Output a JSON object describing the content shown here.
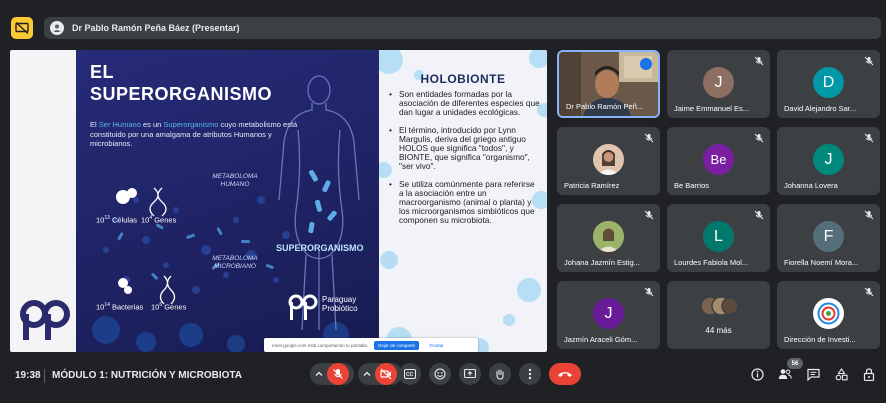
{
  "topbar": {
    "presenter_label": "Dr Pablo Ramón Peña Báez (Presentar)"
  },
  "slide": {
    "title_line1": "EL",
    "title_line2": "SUPERORGANISMO",
    "intro_part1": "El ",
    "intro_hl1": "Ser Humano",
    "intro_part2": " es un ",
    "intro_hl2": "Superorganismo",
    "intro_part3": " cuyo metabolismo está constituido por una amalgama de atributos Humanos y microbianos.",
    "metaboloma_humano": "METABOLOMA HUMANO",
    "metaboloma_microbiano": "METABOLOMA MICROBIANO",
    "celulas": "Células",
    "genes1": "Genes",
    "bacterias": "Bacterias",
    "genes2": "Genes",
    "base": "10",
    "superorganismo_label": "SUPERORGANISMO",
    "logo_text": "Paraguay Probiótico",
    "right_title": "HOLOBIONTE",
    "bullets": [
      "Son entidades formadas por la asociación de diferentes especies que dan lugar a unidades ecológicas.",
      "El término, introducido por Lynn Margulis, deriva del griego antiguo HOLOS que significa \"todos\", y BIONTE, que significa \"organismo\", \"ser vivo\".",
      "Se utiliza comúnmente para referirse a la asociación entre un macroorganismo (animal o planta) y los microorganismos simbióticos que componen su microbiota."
    ]
  },
  "share_bar": {
    "text": "meet.google.com está compartiendo tu pantalla.",
    "stop_button": "Dejar de compartir",
    "hide_link": "Ocultar"
  },
  "participants": [
    {
      "name": "Dr Pablo Ramón Peñ...",
      "initial": "",
      "color": ""
    },
    {
      "name": "Jaime Emmanuel Es...",
      "initial": "J",
      "color": "#8d6e63"
    },
    {
      "name": "David Alejandro Sar...",
      "initial": "D",
      "color": "#0097a7"
    },
    {
      "name": "Patricia Ramírez",
      "initial": "",
      "color": "#e0c4b0"
    },
    {
      "name": "Be Barrios",
      "initial": "Be",
      "color": "#7b1fa2"
    },
    {
      "name": "Johanna Lovera",
      "initial": "J",
      "color": "#00897b"
    },
    {
      "name": "Johana Jazmín Estig...",
      "initial": "",
      "color": "#b8a070"
    },
    {
      "name": "Lourdes Fabiola Mol...",
      "initial": "L",
      "color": "#00796b"
    },
    {
      "name": "Fiorella Noemí Mora...",
      "initial": "F",
      "color": "#546e7a"
    },
    {
      "name": "Jazmín Araceli Góm...",
      "initial": "J",
      "color": "#6a1b9a"
    },
    {
      "name": "44 más",
      "initial": "",
      "color": ""
    },
    {
      "name": "Dirección de Investi...",
      "initial": "",
      "color": "#ffffff"
    }
  ],
  "bottombar": {
    "time": "19:38",
    "meeting_title": "MÓDULO 1: NUTRICIÓN Y MICROBIOTA",
    "participant_count": "56"
  },
  "icons": [
    "present-off-icon",
    "mic-off-icon",
    "cam-off-icon",
    "captions-icon",
    "emoji-icon",
    "present-icon",
    "raise-hand-icon",
    "more-icon",
    "end-call-icon",
    "info-icon",
    "people-icon",
    "chat-icon",
    "activities-icon",
    "host-lock-icon"
  ],
  "colors": {
    "accent": "#fcc934",
    "end_call": "#ea4335",
    "tile_bg": "#3c4043",
    "bg": "#202124"
  }
}
